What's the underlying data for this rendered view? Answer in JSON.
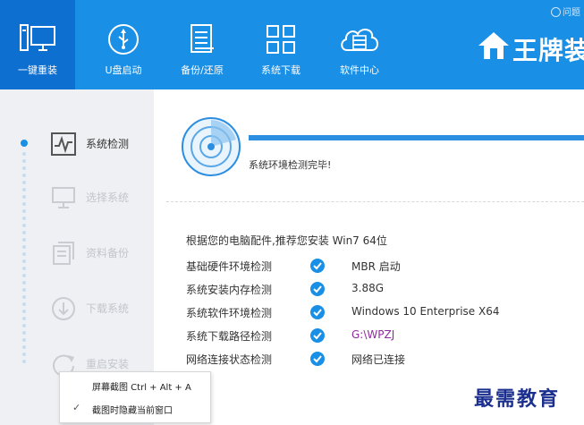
{
  "header": {
    "help_text": "问题",
    "brand_text": "王牌装",
    "nav": [
      {
        "label": "一键重装",
        "icon": "monitor-icon",
        "active": true
      },
      {
        "label": "U盘启动",
        "icon": "usb-icon",
        "active": false
      },
      {
        "label": "备份/还原",
        "icon": "document-icon",
        "active": false
      },
      {
        "label": "系统下载",
        "icon": "grid-icon",
        "active": false
      },
      {
        "label": "软件中心",
        "icon": "cloud-icon",
        "active": false
      }
    ]
  },
  "sidebar": {
    "steps": [
      {
        "label": "系统检测",
        "icon": "pulse-icon",
        "state": "done"
      },
      {
        "label": "选择系统",
        "icon": "desktop-icon",
        "state": "pending"
      },
      {
        "label": "资料备份",
        "icon": "files-icon",
        "state": "pending"
      },
      {
        "label": "下载系统",
        "icon": "download-icon",
        "state": "pending"
      },
      {
        "label": "重启安装",
        "icon": "restart-icon",
        "state": "pending"
      }
    ]
  },
  "main": {
    "progress": 1.0,
    "status_text": "系统环境检测完毕!",
    "recommendation": "根据您的电脑配件,推荐您安装 Win7 64位",
    "checks": [
      {
        "label": "基础硬件环境检测",
        "value": "MBR 启动"
      },
      {
        "label": "系统安装内存检测",
        "value": "3.88G"
      },
      {
        "label": "系统软件环境检测",
        "value": "Windows 10 Enterprise X64"
      },
      {
        "label": "系统下载路径检测",
        "value": "G:\\WPZJ"
      },
      {
        "label": "网络连接状态检测",
        "value": "网络已连接"
      }
    ]
  },
  "context_menu": {
    "items": [
      {
        "label": "屏幕截图 Ctrl + Alt + A",
        "checked": false
      },
      {
        "label": "截图时隐藏当前窗口",
        "checked": true
      }
    ]
  },
  "watermark": "最需教育",
  "colors": {
    "accent": "#1a8fe6",
    "accent_dark": "#0d6fcf",
    "check": "#1a8fe6",
    "path_value": "#8e2aa0",
    "watermark": "#1b2f8f"
  }
}
